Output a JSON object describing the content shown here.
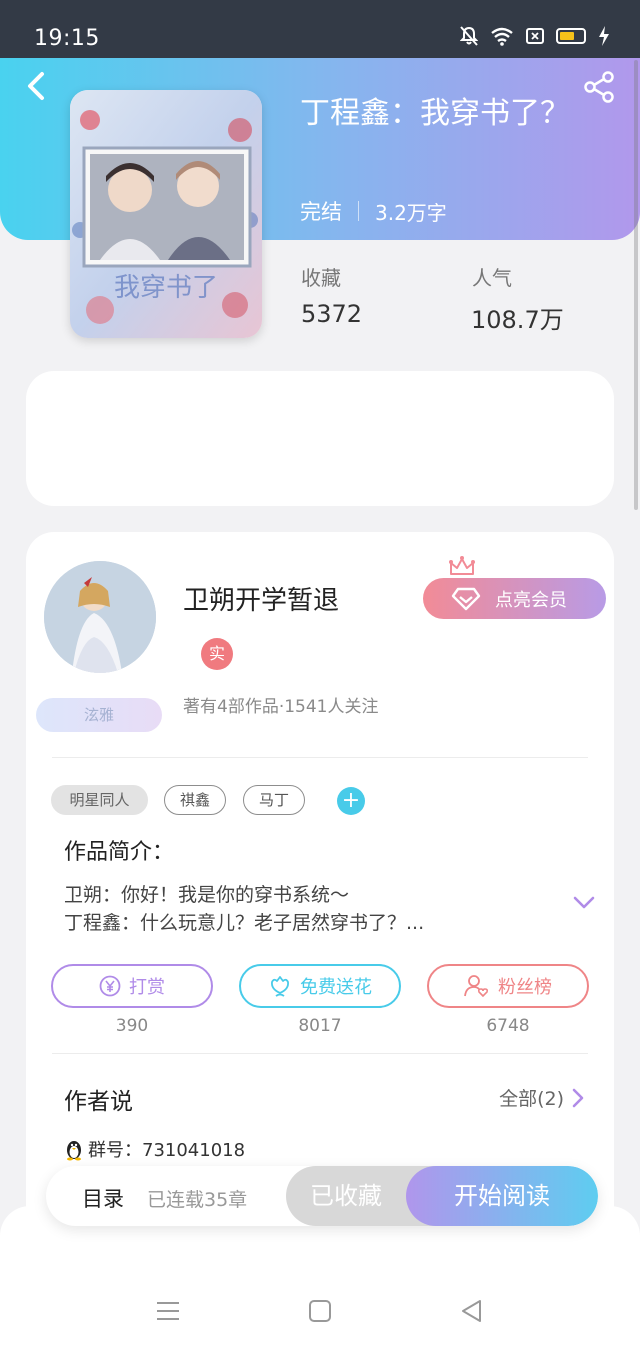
{
  "status_bar": {
    "time": "19:15"
  },
  "book": {
    "title": "丁程鑫：我穿书了？",
    "status": "完结",
    "word_count": "3.2万字",
    "stats": [
      {
        "label": "收藏",
        "value": "5372"
      },
      {
        "label": "人气",
        "value": "108.7万"
      }
    ]
  },
  "author": {
    "name": "卫朔开学暂退",
    "badge": "实",
    "level_badge": "泫雅",
    "meta": "著有4部作品·1541人关注",
    "vip_button": "点亮会员"
  },
  "tags": [
    "明星同人",
    "祺鑫",
    "马丁"
  ],
  "intro": {
    "title": "作品简介：",
    "lines": [
      "卫朔：你好！我是你的穿书系统～",
      "丁程鑫：什么玩意儿？老子居然穿书了？..."
    ]
  },
  "actions": [
    {
      "label": "打赏",
      "count": "390",
      "color": "#b08be8"
    },
    {
      "label": "免费送花",
      "count": "8017",
      "color": "#48cbe9"
    },
    {
      "label": "粉丝榜",
      "count": "6748",
      "color": "#ef8587"
    }
  ],
  "author_says": {
    "title": "作者说",
    "view_all": "全部(2)",
    "group_line": "群号：731041018"
  },
  "bottom_bar": {
    "toc": "目录",
    "serial": "已连载35章",
    "collected": "已收藏",
    "start_read": "开始阅读"
  }
}
